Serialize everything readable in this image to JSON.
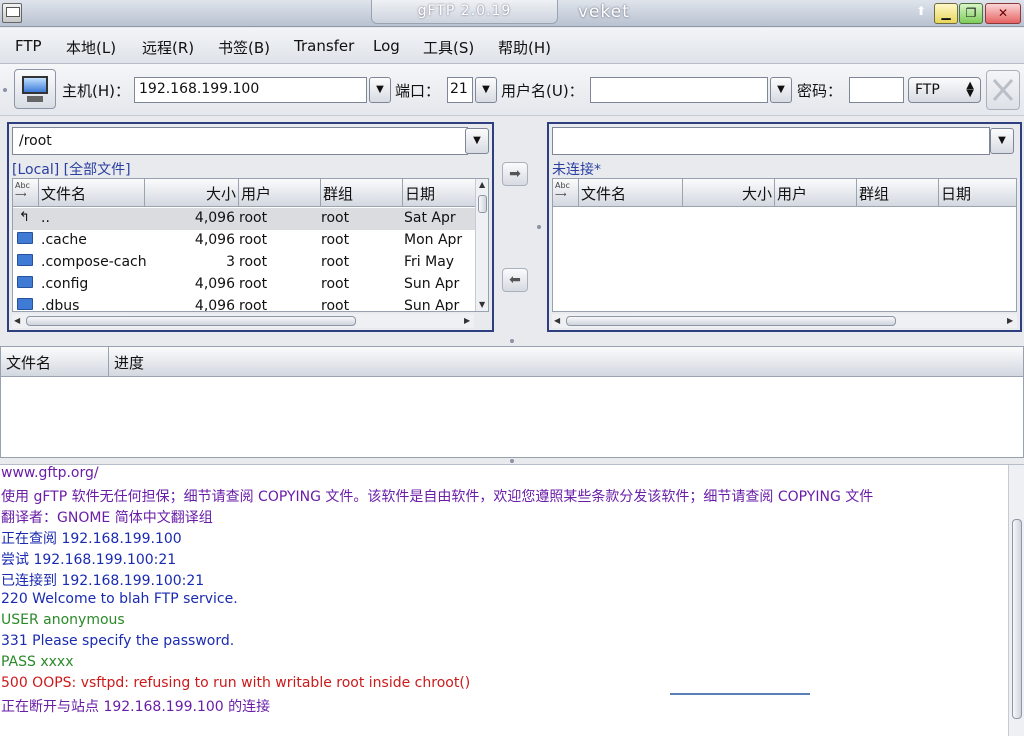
{
  "window": {
    "title": "gFTP 2.0.19",
    "user": "veket",
    "up_arrow": "⬆"
  },
  "menu": [
    "FTP",
    "本地(L)",
    "远程(R)",
    "书签(B)",
    "Transfer",
    "Log",
    "工具(S)",
    "帮助(H)"
  ],
  "toolbar": {
    "host_label": "主机(H)：",
    "host_value": "192.168.199.100",
    "port_label": "端口：",
    "port_value": "21",
    "user_label": "用户名(U)：",
    "user_value": "",
    "pass_label": "密码：",
    "pass_value": "",
    "protocol": "FTP"
  },
  "local": {
    "path": "/root",
    "status": "[Local] [全部文件]",
    "columns": {
      "name": "文件名",
      "size": "大小",
      "user": "用户",
      "group": "群组",
      "date": "日期"
    },
    "rows": [
      {
        "name": "..",
        "size": "4,096",
        "user": "root",
        "group": "root",
        "date": "Sat Apr",
        "type": "up"
      },
      {
        "name": ".cache",
        "size": "4,096",
        "user": "root",
        "group": "root",
        "date": "Mon Apr",
        "type": "folder"
      },
      {
        "name": ".compose-cach",
        "size": "3",
        "user": "root",
        "group": "root",
        "date": "Fri May",
        "type": "folder"
      },
      {
        "name": ".config",
        "size": "4,096",
        "user": "root",
        "group": "root",
        "date": "Sun Apr",
        "type": "folder"
      },
      {
        "name": ".dbus",
        "size": "4,096",
        "user": "root",
        "group": "root",
        "date": "Sun Apr",
        "type": "folder"
      }
    ]
  },
  "remote": {
    "path": "",
    "status": "未连接*",
    "columns": {
      "name": "文件名",
      "size": "大小",
      "user": "用户",
      "group": "群组",
      "date": "日期"
    }
  },
  "queue": {
    "columns": {
      "name": "文件名",
      "progress": "进度"
    }
  },
  "log": [
    {
      "text": "www.gftp.org/",
      "color": "purple"
    },
    {
      "text": "使用 gFTP 软件无任何担保；细节请查阅 COPYING 文件。该软件是自由软件，欢迎您遵照某些条款分发该软件；细节请查阅 COPYING 文件",
      "color": "purple"
    },
    {
      "text": "翻译者：GNOME 简体中文翻译组",
      "color": "purple"
    },
    {
      "text": "正在查阅 192.168.199.100",
      "color": "blue"
    },
    {
      "text": "尝试 192.168.199.100:21",
      "color": "blue"
    },
    {
      "text": "已连接到 192.168.199.100:21",
      "color": "blue"
    },
    {
      "text": "220 Welcome to blah FTP service.",
      "color": "blue"
    },
    {
      "text": "USER anonymous",
      "color": "green"
    },
    {
      "text": "331 Please specify the password.",
      "color": "blue"
    },
    {
      "text": "PASS xxxx",
      "color": "green"
    },
    {
      "text": "500 OOPS: vsftpd: refusing to run with writable root inside chroot()",
      "color": "red"
    },
    {
      "text": "正在断开与站点 192.168.199.100 的连接",
      "color": "purple"
    }
  ],
  "colors": {
    "purple": "#6a1ea8",
    "blue": "#1a2bb0",
    "green": "#2a8a2a",
    "red": "#cc1a1a",
    "panel_border": "#2e3f80"
  }
}
